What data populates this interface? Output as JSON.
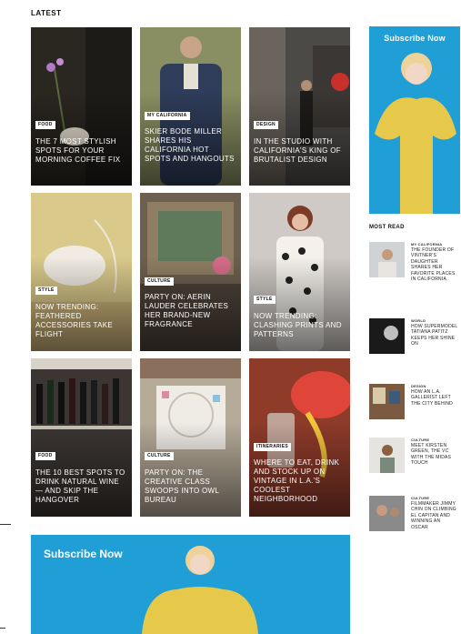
{
  "section_label": "LATEST",
  "cards": [
    {
      "tag": "FOOD",
      "headline": "THE 7 MOST STYLISH SPOTS FOR YOUR MORNING COFFEE FIX",
      "tone": "#2a2620"
    },
    {
      "tag": "MY CALIFORNIA",
      "headline": "SKIER BODE MILLER SHARES HIS CALIFORNIA HOT SPOTS AND HANGOUTS",
      "tone": "#8a8f63"
    },
    {
      "tag": "DESIGN",
      "headline": "IN THE STUDIO WITH CALIFORNIA'S KING OF BRUTALIST DESIGN",
      "tone": "#4c4a47"
    },
    {
      "tag": "STYLE",
      "headline": "NOW TRENDING: FEATHERED ACCESSORIES TAKE FLIGHT",
      "tone": "#d9c98b"
    },
    {
      "tag": "CULTURE",
      "headline": "PARTY ON: AERIN LAUDER CELEBRATES HER BRAND-NEW FRAGRANCE",
      "tone": "#6e6050"
    },
    {
      "tag": "STYLE",
      "headline": "NOW TRENDING: CLASHING PRINTS AND PATTERNS",
      "tone": "#cfcac6"
    },
    {
      "tag": "FOOD",
      "headline": "THE 10 BEST SPOTS TO DRINK NATURAL WINE — AND SKIP THE HANGOVER",
      "tone": "#3b3633"
    },
    {
      "tag": "CULTURE",
      "headline": "PARTY ON: THE CREATIVE CLASS SWOOPS INTO OWL BUREAU",
      "tone": "#b6aa99"
    },
    {
      "tag": "ITINERARIES",
      "headline": "WHERE TO EAT, DRINK AND STOCK UP ON VINTAGE IN L.A.'S COOLEST NEIGHBORHOOD",
      "tone": "#8e3b2a"
    }
  ],
  "rail_ad": {
    "title": "Subscribe Now"
  },
  "most_read": {
    "label": "MOST READ",
    "items": [
      {
        "tag": "MY CALIFORNIA",
        "text": "THE FOUNDER OF VINTNER'S DAUGHTER SHARES HER FAVORITE PLACES IN CALIFORNIA"
      },
      {
        "tag": "WORLD",
        "text": "HOW SUPERMODEL TATIANA PATITZ KEEPS HER SHINE ON"
      },
      {
        "tag": "DESIGN",
        "text": "HOW AN L.A. GALLERIST LEFT THE CITY BEHIND"
      },
      {
        "tag": "CULTURE",
        "text": "MEET KIRSTEN GREEN, THE VC WITH THE MIDAS TOUCH"
      },
      {
        "tag": "CULTURE",
        "text": "FILMMAKER JIMMY CHIN ON CLIMBING EL CAPITAN AND WINNING AN OSCAR"
      }
    ]
  },
  "bottom_banner": {
    "title": "Subscribe Now"
  },
  "colors": {
    "ad_blue": "#1f9fd6",
    "yellow_dress": "#e6c94a"
  }
}
